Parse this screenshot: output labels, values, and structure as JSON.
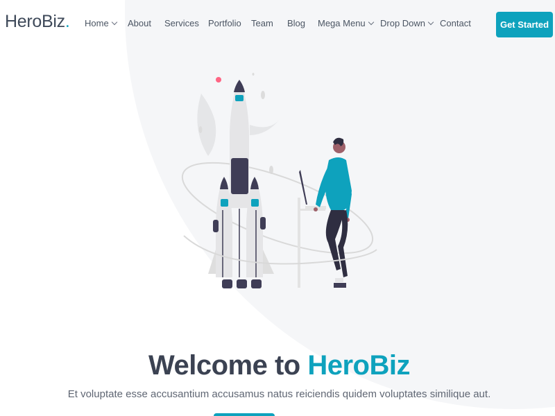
{
  "brand": {
    "name": "HeroBiz",
    "dot": ".",
    "accent_color": "#0ea2bd"
  },
  "nav": {
    "items": [
      {
        "label": "Home",
        "dropdown": true
      },
      {
        "label": "About",
        "dropdown": false
      },
      {
        "label": "Services",
        "dropdown": false
      },
      {
        "label": "Portfolio",
        "dropdown": false
      },
      {
        "label": "Team",
        "dropdown": false
      },
      {
        "label": "Blog",
        "dropdown": false
      },
      {
        "label": "Mega Menu",
        "dropdown": true
      },
      {
        "label": "Drop Down",
        "dropdown": true
      },
      {
        "label": "Contact",
        "dropdown": false
      }
    ],
    "cta_label": "Get Started"
  },
  "hero": {
    "title_prefix": "Welcome to ",
    "title_accent": "HeroBiz",
    "subtitle": "Et voluptate esse accusantium accusamus natus reiciendis quidem voluptates similique aut.",
    "illustration": "rocket-launch-person-laptop-illustration"
  }
}
